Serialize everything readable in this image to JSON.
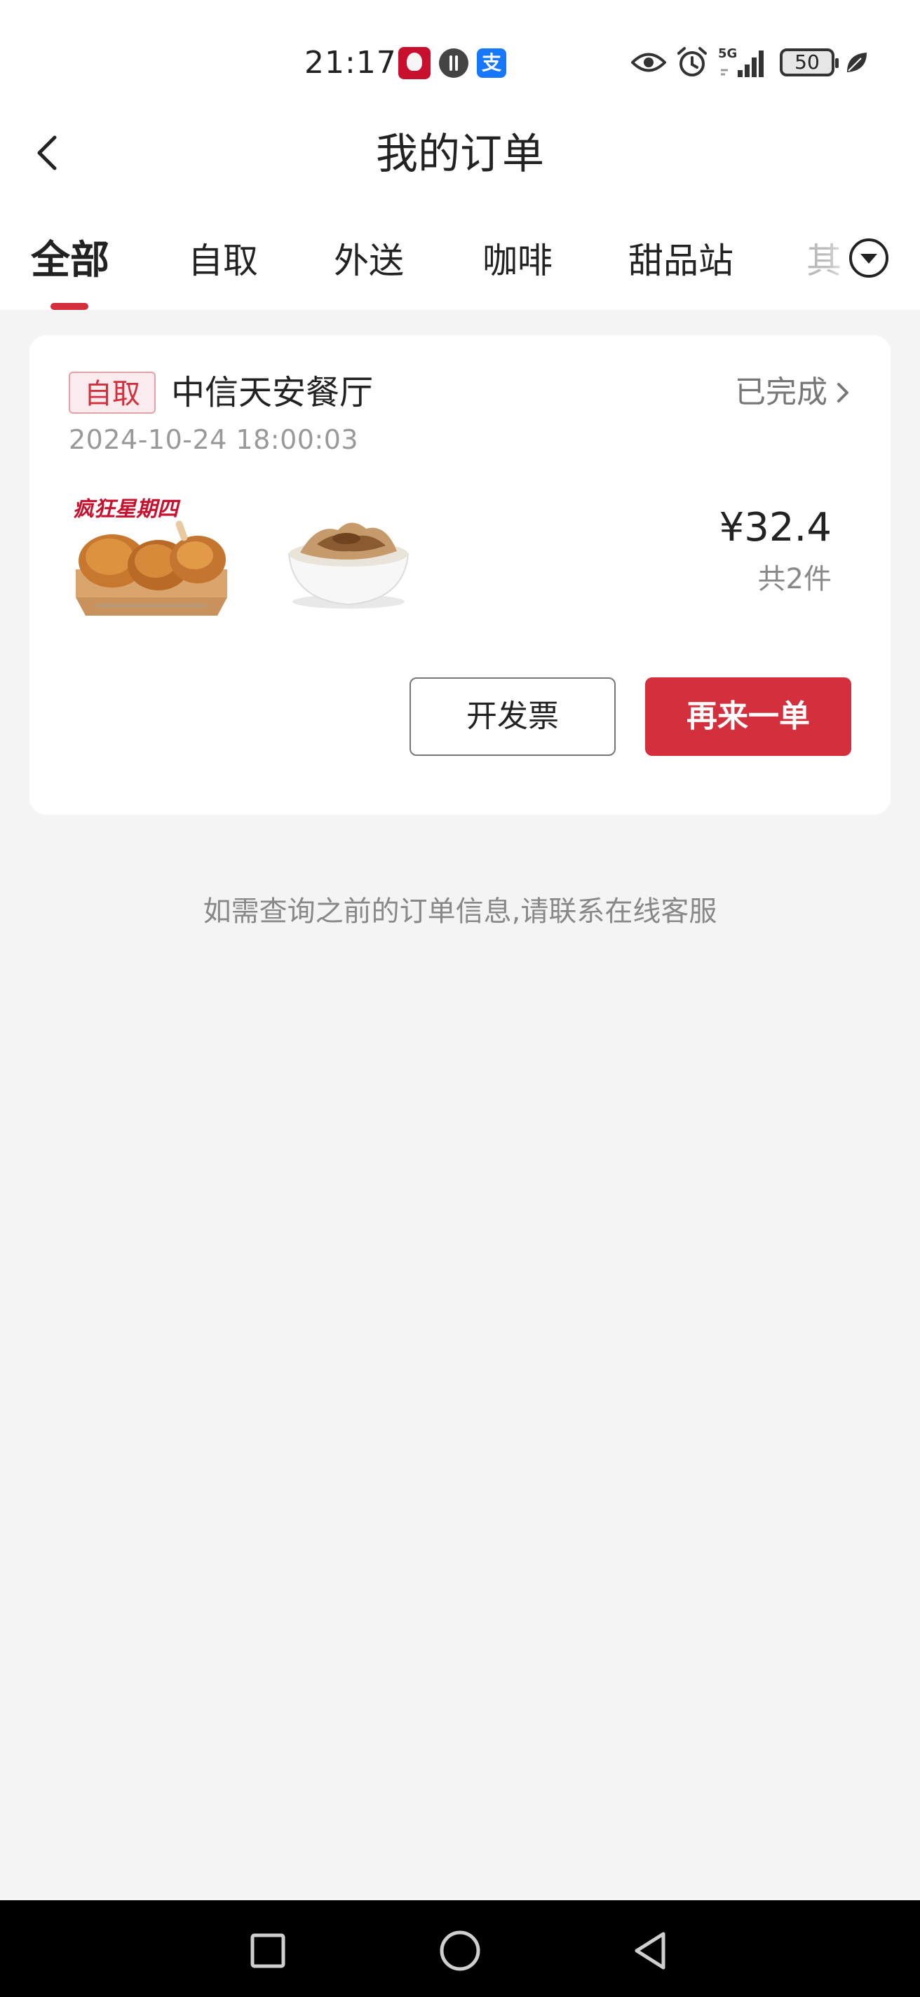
{
  "status_bar": {
    "time": "21:17",
    "alipay_glyph": "支",
    "battery": "50",
    "network": "5G",
    "icons": [
      "kfc-app-icon",
      "circle-app-icon",
      "alipay-icon",
      "eye-icon",
      "alarm-icon",
      "signal-icon",
      "battery-icon",
      "leaf-icon"
    ]
  },
  "header": {
    "title": "我的订单"
  },
  "tabs": {
    "items": [
      {
        "label": "全部",
        "active": true
      },
      {
        "label": "自取",
        "active": false
      },
      {
        "label": "外送",
        "active": false
      },
      {
        "label": "咖啡",
        "active": false
      },
      {
        "label": "甜品站",
        "active": false
      },
      {
        "label": "其",
        "active": false
      }
    ]
  },
  "order": {
    "type_badge": "自取",
    "store": "中信天安餐厅",
    "status": "已完成",
    "time": "2024-10-24 18:00:03",
    "price": "¥32.4",
    "count": "共2件",
    "product_1_caption": "疯狂星期四",
    "actions": {
      "invoice": "开发票",
      "reorder": "再来一单"
    }
  },
  "footnote": "如需查询之前的订单信息,请联系在线客服",
  "colors": {
    "accent": "#d32f3c",
    "background": "#f4f4f4",
    "card": "#ffffff"
  }
}
